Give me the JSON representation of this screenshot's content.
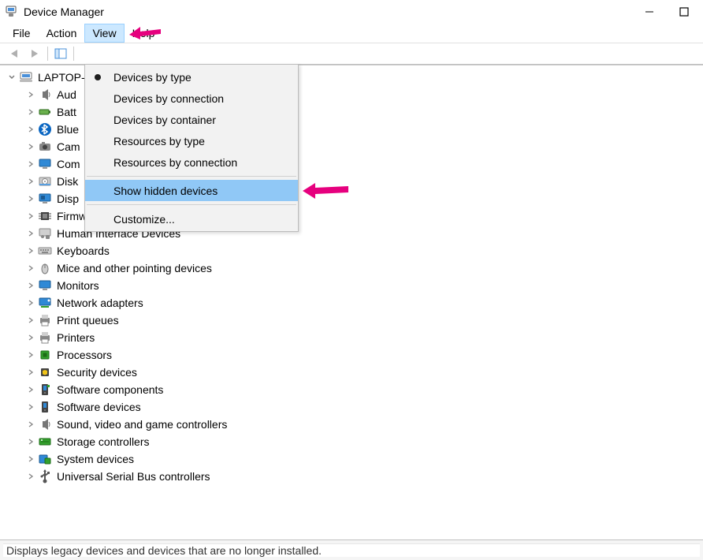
{
  "title": "Device Manager",
  "menubar": {
    "file": "File",
    "action": "Action",
    "view": "View",
    "help": "Help"
  },
  "view_menu": {
    "devices_by_type": "Devices by type",
    "devices_by_connection": "Devices by connection",
    "devices_by_container": "Devices by container",
    "resources_by_type": "Resources by type",
    "resources_by_connection": "Resources by connection",
    "show_hidden_devices": "Show hidden devices",
    "customize": "Customize..."
  },
  "tree": {
    "root": "LAPTOP-",
    "nodes": [
      {
        "label": "Aud",
        "icon": "speaker"
      },
      {
        "label": "Batt",
        "icon": "battery"
      },
      {
        "label": "Blue",
        "icon": "bluetooth"
      },
      {
        "label": "Cam",
        "icon": "camera"
      },
      {
        "label": "Com",
        "icon": "monitor"
      },
      {
        "label": "Disk",
        "icon": "disk"
      },
      {
        "label": "Disp",
        "icon": "display-adapter"
      },
      {
        "label": "Firmware",
        "icon": "chip"
      },
      {
        "label": "Human Interface Devices",
        "icon": "hid"
      },
      {
        "label": "Keyboards",
        "icon": "keyboard"
      },
      {
        "label": "Mice and other pointing devices",
        "icon": "mouse"
      },
      {
        "label": "Monitors",
        "icon": "monitor"
      },
      {
        "label": "Network adapters",
        "icon": "network"
      },
      {
        "label": "Print queues",
        "icon": "printer"
      },
      {
        "label": "Printers",
        "icon": "printer"
      },
      {
        "label": "Processors",
        "icon": "cpu"
      },
      {
        "label": "Security devices",
        "icon": "security"
      },
      {
        "label": "Software components",
        "icon": "software-component"
      },
      {
        "label": "Software devices",
        "icon": "software-device"
      },
      {
        "label": "Sound, video and game controllers",
        "icon": "speaker"
      },
      {
        "label": "Storage controllers",
        "icon": "storage"
      },
      {
        "label": "System devices",
        "icon": "system"
      },
      {
        "label": "Universal Serial Bus controllers",
        "icon": "usb"
      }
    ]
  },
  "statusbar": "Displays legacy devices and devices that are no longer installed.",
  "accent_highlight": "#90c8f6",
  "annotation_color": "#e6007e"
}
